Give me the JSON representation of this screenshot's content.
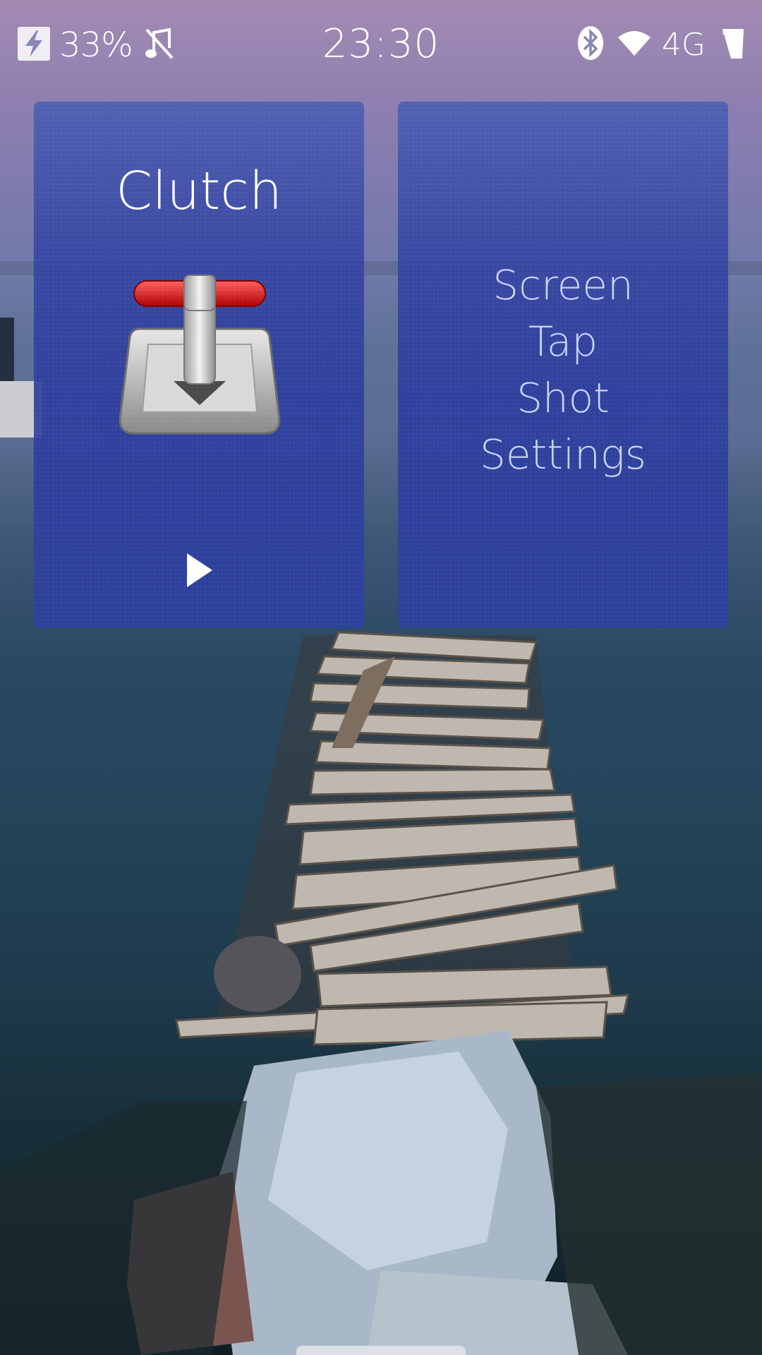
{
  "status_bar": {
    "battery_percent": "33%",
    "time": "23:30",
    "network": "4G",
    "icons": [
      "charging-bolt-icon",
      "silent-mode-icon",
      "bluetooth-icon",
      "wifi-icon",
      "cellular-signal-icon"
    ]
  },
  "covers": [
    {
      "title": "Clutch",
      "icon": "joystick-icon",
      "action_icon": "play-icon"
    },
    {
      "lines": [
        "Screen",
        "Tap",
        "Shot",
        "Settings"
      ]
    }
  ],
  "colors": {
    "cover_tint": "#3a4aa8",
    "status_text": "#ffffff",
    "settings_text": "#c8d2f4",
    "clutch_handle_red": "#d81c1c"
  }
}
